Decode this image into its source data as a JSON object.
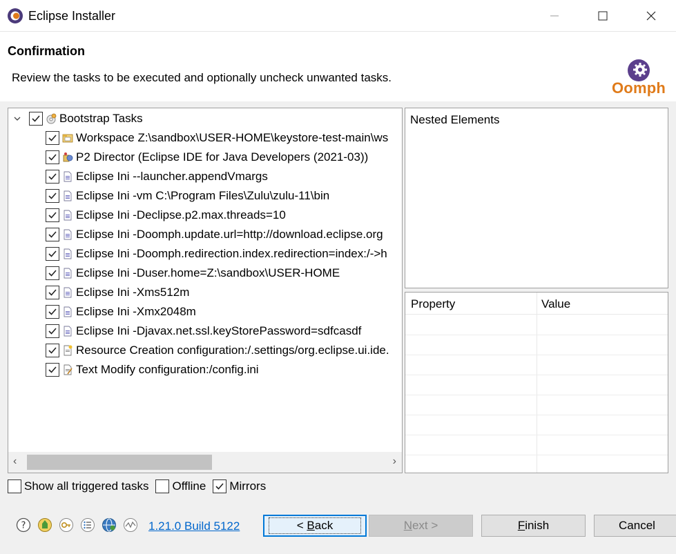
{
  "window": {
    "title": "Eclipse Installer"
  },
  "header": {
    "title": "Confirmation",
    "description": "Review the tasks to be executed and optionally uncheck unwanted tasks.",
    "logo_text": "Oomph"
  },
  "tree": {
    "root": {
      "label": "Bootstrap Tasks",
      "checked": true,
      "icon": "bootstrap-icon"
    },
    "items": [
      {
        "label": "Workspace Z:\\sandbox\\USER-HOME\\keystore-test-main\\ws",
        "icon": "workspace-icon"
      },
      {
        "label": "P2 Director (Eclipse IDE for Java Developers (2021-03))",
        "icon": "p2-director-icon"
      },
      {
        "label": "Eclipse Ini --launcher.appendVmargs",
        "icon": "ini-file-icon"
      },
      {
        "label": "Eclipse Ini -vm C:\\Program Files\\Zulu\\zulu-11\\bin",
        "icon": "ini-file-icon"
      },
      {
        "label": "Eclipse Ini -Declipse.p2.max.threads=10",
        "icon": "ini-file-icon"
      },
      {
        "label": "Eclipse Ini -Doomph.update.url=http://download.eclipse.org",
        "icon": "ini-file-icon"
      },
      {
        "label": "Eclipse Ini -Doomph.redirection.index.redirection=index:/->h",
        "icon": "ini-file-icon"
      },
      {
        "label": "Eclipse Ini -Duser.home=Z:\\sandbox\\USER-HOME",
        "icon": "ini-file-icon"
      },
      {
        "label": "Eclipse Ini -Xms512m",
        "icon": "ini-file-icon"
      },
      {
        "label": "Eclipse Ini -Xmx2048m",
        "icon": "ini-file-icon"
      },
      {
        "label": "Eclipse Ini -Djavax.net.ssl.keyStorePassword=sdfcasdf",
        "icon": "ini-file-icon"
      },
      {
        "label": "Resource Creation configuration:/.settings/org.eclipse.ui.ide.",
        "icon": "resource-creation-icon"
      },
      {
        "label": "Text Modify configuration:/config.ini",
        "icon": "text-modify-icon"
      }
    ]
  },
  "nested": {
    "label": "Nested Elements"
  },
  "properties": {
    "col_property": "Property",
    "col_value": "Value"
  },
  "options": {
    "show_all": {
      "label": "Show all triggered tasks",
      "checked": false
    },
    "offline": {
      "label": "Offline",
      "checked": false
    },
    "mirrors": {
      "label": "Mirrors",
      "checked": true
    }
  },
  "footer": {
    "version": "1.21.0 Build 5122",
    "back": {
      "prefix": "< ",
      "mnemonic": "B",
      "rest": "ack"
    },
    "next": {
      "mnemonic": "N",
      "rest": "ext >"
    },
    "finish": {
      "mnemonic": "F",
      "rest": "inish"
    },
    "cancel": "Cancel"
  },
  "colors": {
    "accent": "#0078d7",
    "link": "#0066cc",
    "oomph_orange": "#e07b1a",
    "oomph_purple": "#5b3f8c"
  }
}
